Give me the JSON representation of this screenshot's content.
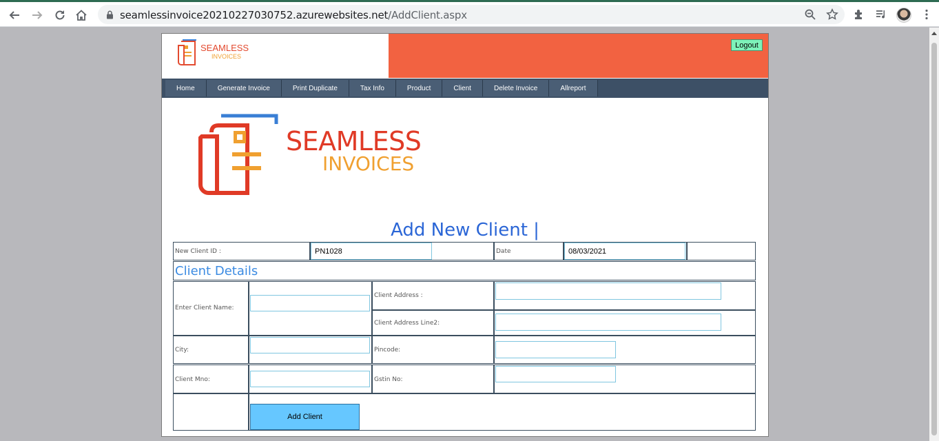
{
  "browser": {
    "url_host": "seamlessinvoice20210227030752.azurewebsites.net",
    "url_path": "/AddClient.aspx",
    "icons": [
      "back-icon",
      "forward-icon",
      "reload-icon",
      "home-icon",
      "lock-icon",
      "zoom-icon",
      "star-icon",
      "extensions-icon",
      "media-icon",
      "avatar",
      "menu-icon"
    ]
  },
  "header": {
    "logo_line1": "SEAMLESS",
    "logo_line2": "INVOICES",
    "logout_label": "Logout",
    "accent_color": "#f26241"
  },
  "menu": {
    "items": [
      "Home",
      "Generate Invoice",
      "Print Duplicate",
      "Tax Info",
      "Product",
      "Client",
      "Delete Invoice",
      "Allreport"
    ]
  },
  "hero_logo": {
    "line1": "SEAMLESS",
    "line2": "INVOICES"
  },
  "page_title": "Add New Client |",
  "form": {
    "client_id_label": "New Client ID :",
    "client_id_value": "PN1028",
    "date_label": "Date",
    "date_value": "08/03/2021",
    "section_title": "Client Details",
    "client_name_label": "Enter Client Name:",
    "client_name_value": "",
    "client_address_label": "Client Address :",
    "client_address_value": "",
    "client_address2_label": "Client Address Line2:",
    "client_address2_value": "",
    "city_label": "City:",
    "city_value": "",
    "pincode_label": "Pincode:",
    "pincode_value": "",
    "mno_label": "Client Mno:",
    "mno_value": "",
    "gstin_label": "Gstin No:",
    "gstin_value": "",
    "add_button_label": "Add Client"
  }
}
